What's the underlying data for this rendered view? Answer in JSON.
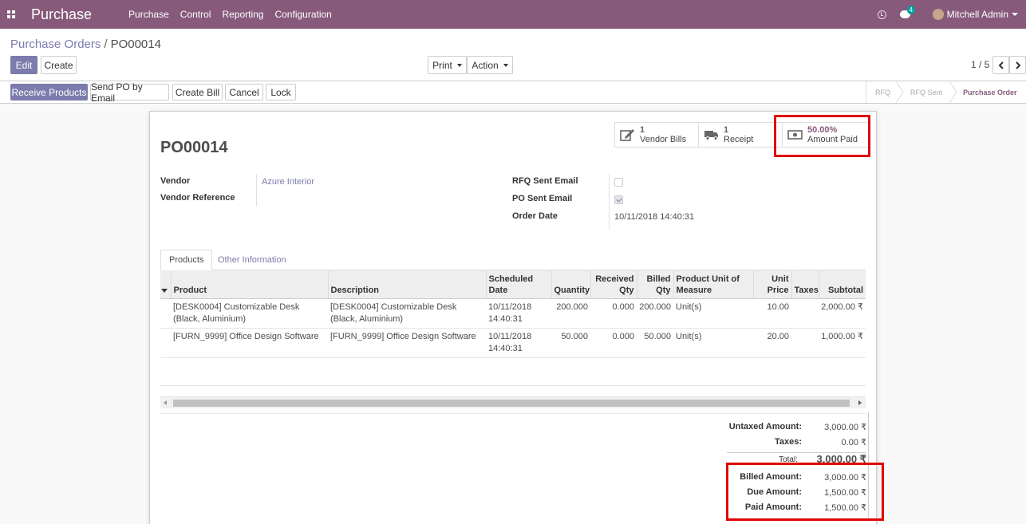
{
  "navbar": {
    "app_name": "Purchase",
    "menu": [
      "Purchase",
      "Control",
      "Reporting",
      "Configuration"
    ],
    "messages_count": "4",
    "user_name": "Mitchell Admin"
  },
  "breadcrumb": {
    "parent": "Purchase Orders",
    "separator": "/",
    "current": "PO00014"
  },
  "actions": {
    "edit": "Edit",
    "create": "Create",
    "print": "Print",
    "action": "Action"
  },
  "pager": {
    "value": "1 / 5"
  },
  "status_buttons": {
    "receive_products": "Receive Products",
    "send_po_email": "Send PO by Email",
    "create_bill": "Create Bill",
    "cancel": "Cancel",
    "lock": "Lock"
  },
  "stages": {
    "rfq": "RFQ",
    "rfq_sent": "RFQ Sent",
    "purchase_order": "Purchase Order",
    "active": "Purchase Order"
  },
  "smart_buttons": {
    "vendor_bills": {
      "num": "1",
      "label": "Vendor Bills"
    },
    "receipt": {
      "num": "1",
      "label": "Receipt"
    },
    "amount_paid": {
      "num": "50.00%",
      "label": "Amount Paid"
    }
  },
  "form": {
    "title": "PO00014",
    "vendor_label": "Vendor",
    "vendor_value": "Azure Interior",
    "vendor_ref_label": "Vendor Reference",
    "rfq_sent_email_label": "RFQ Sent Email",
    "rfq_sent_email_checked": false,
    "po_sent_email_label": "PO Sent Email",
    "po_sent_email_checked": true,
    "order_date_label": "Order Date",
    "order_date_value": "10/11/2018 14:40:31"
  },
  "tabs": {
    "products": "Products",
    "other_info": "Other Information"
  },
  "table": {
    "headers": {
      "product": "Product",
      "description": "Description",
      "scheduled_date": "Scheduled Date",
      "quantity": "Quantity",
      "received_qty": "Received Qty",
      "billed_qty": "Billed Qty",
      "uom": "Product Unit of Measure",
      "unit_price": "Unit Price",
      "taxes": "Taxes",
      "subtotal": "Subtotal"
    },
    "rows": [
      {
        "product": "[DESK0004] Customizable Desk (Black, Aluminium)",
        "description": "[DESK0004] Customizable Desk (Black, Aluminium)",
        "scheduled_date": "10/11/2018 14:40:31",
        "quantity": "200.000",
        "received_qty": "0.000",
        "billed_qty": "200.000",
        "uom": "Unit(s)",
        "unit_price": "10.00",
        "taxes": "",
        "subtotal": "2,000.00 ₹"
      },
      {
        "product": "[FURN_9999] Office Design Software",
        "description": "[FURN_9999] Office Design Software",
        "scheduled_date": "10/11/2018 14:40:31",
        "quantity": "50.000",
        "received_qty": "0.000",
        "billed_qty": "50.000",
        "uom": "Unit(s)",
        "unit_price": "20.00",
        "taxes": "",
        "subtotal": "1,000.00 ₹"
      }
    ]
  },
  "totals": {
    "untaxed_label": "Untaxed Amount:",
    "untaxed_value": "3,000.00 ₹",
    "taxes_label": "Taxes:",
    "taxes_value": "0.00 ₹",
    "total_label": "Total:",
    "total_value": "3,000.00 ₹",
    "billed_label": "Billed Amount:",
    "billed_value": "3,000.00 ₹",
    "due_label": "Due Amount:",
    "due_value": "1,500.00 ₹",
    "paid_label": "Paid Amount:",
    "paid_value": "1,500.00 ₹"
  },
  "colors": {
    "brand": "#875A7B",
    "primary": "#7C7BAD",
    "highlight": "#E00000"
  }
}
